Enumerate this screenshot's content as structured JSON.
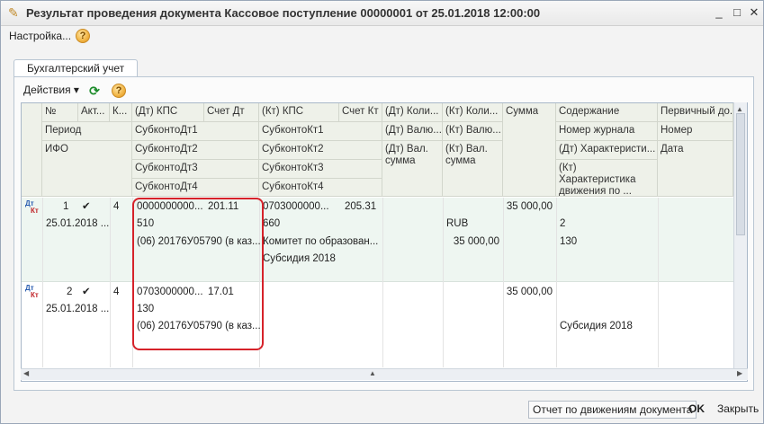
{
  "window": {
    "title": "Результат проведения документа Кассовое поступление 00000001 от 25.01.2018 12:00:00",
    "min_glyph": "_",
    "max_glyph": "□",
    "close_glyph": "✕"
  },
  "toolbar": {
    "setup_label": "Настройка...",
    "help_glyph": "?"
  },
  "tab": {
    "label": "Бухгалтерский учет"
  },
  "grid_toolbar": {
    "actions_label": "Действия ▾",
    "refresh_glyph": "⟳",
    "help_glyph": "?"
  },
  "headers": {
    "num": "№",
    "period": "Период",
    "ifo": "ИФО",
    "active": "Акт...",
    "k": "К...",
    "dt_kps": "(Дт) КПС",
    "dt_sub1": "СубконтоДт1",
    "dt_sub2": "СубконтоДт2",
    "dt_sub3": "СубконтоДт3",
    "dt_sub4": "СубконтоДт4",
    "acc_dt": "Счет Дт",
    "kt_kps": "(Кт) КПС",
    "kt_sub1": "СубконтоКт1",
    "kt_sub2": "СубконтоКт2",
    "kt_sub3": "СубконтоКт3",
    "kt_sub4": "СубконтоКт4",
    "acc_kt": "Счет Кт",
    "dt_qty": "(Дт) Коли...",
    "dt_cur": "(Дт) Валю...",
    "dt_cursum": "(Дт) Вал. сумма",
    "kt_qty": "(Кт) Коли...",
    "kt_cur": "(Кт) Валю...",
    "kt_cursum": "(Кт) Вал. сумма",
    "sum": "Сумма",
    "content": "Содержание",
    "journal": "Номер журнала",
    "dt_char": "(Дт) Характеристи...",
    "kt_char": "(Кт) Характеристика движения по ...",
    "primary": "Первичный до...",
    "number": "Номер",
    "date": "Дата"
  },
  "rows": [
    {
      "dt": "Дт",
      "kt": "Кт",
      "num": "1",
      "check": "✔",
      "k": "4",
      "period": "25.01.2018 ...",
      "dt_kps": "0000000000...",
      "acc_dt": "201.11",
      "dt_sub1": "510",
      "dt_sub2": "(06) 20176У05790 (в каз...",
      "kt_kps": "0703000000...",
      "acc_kt": "205.31",
      "kt_sub1": "660",
      "kt_sub2": "Комитет по образован...",
      "kt_sub3": "Субсидия 2018",
      "dt_cur": "RUB",
      "dt_cursum": "35 000,00",
      "sum": "35 000,00",
      "journal": "2",
      "dt_char": "130",
      "kt_char": ""
    },
    {
      "dt": "Дт",
      "kt": "Кт",
      "num": "2",
      "check": "✔",
      "k": "4",
      "period": "25.01.2018 ...",
      "dt_kps": "0703000000...",
      "acc_dt": "17.01",
      "dt_sub1": "130",
      "dt_sub2": "(06) 20176У05790 (в каз...",
      "kt_kps": "",
      "acc_kt": "",
      "kt_sub1": "",
      "kt_sub2": "",
      "kt_sub3": "",
      "dt_cur": "",
      "dt_cursum": "",
      "sum": "35 000,00",
      "journal": "",
      "dt_char": "Субсидия 2018",
      "kt_char": ""
    }
  ],
  "bottom": {
    "report_label": "Отчет по движениям документа",
    "ok_label": "OK",
    "close_label": "Закрыть"
  },
  "colors": {
    "accent_red": "#d6222a",
    "row_tint": "#eef6f1",
    "header_bg": "#eef1e9"
  }
}
